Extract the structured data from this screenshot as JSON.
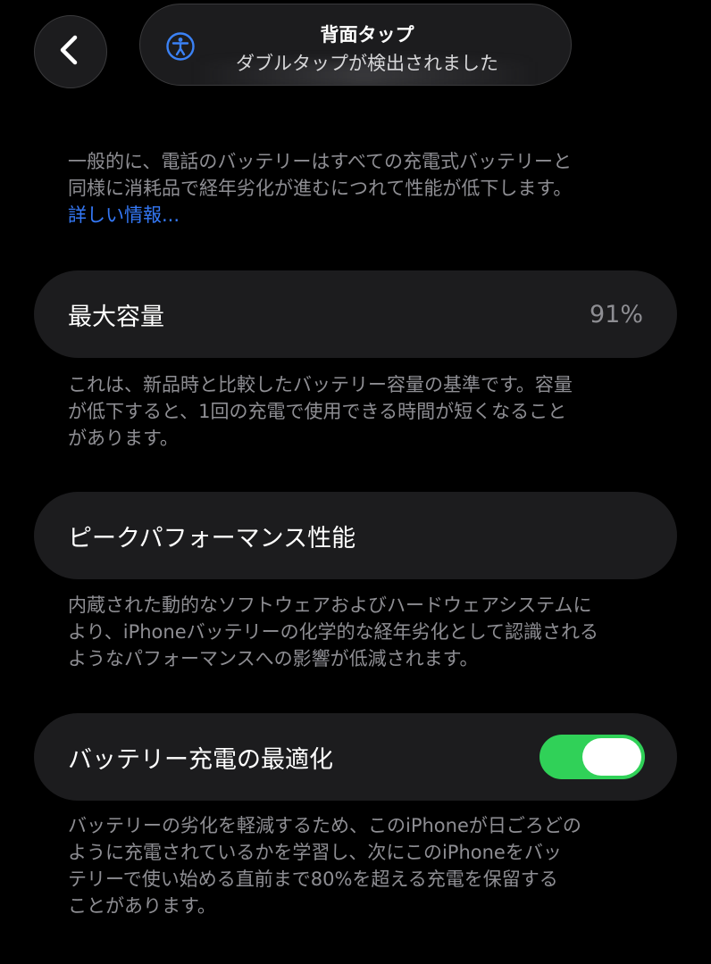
{
  "nav": {
    "back_icon": "chevron-left-icon"
  },
  "banner": {
    "icon": "accessibility-icon",
    "title": "背面タップ",
    "subtitle": "ダブルタップが検出されました"
  },
  "intro": {
    "line1": "一般的に、電話のバッテリーはすべての充電式バッテリーと",
    "line2": "同様に消耗品で経年劣化が進むにつれて性能が低下します。",
    "link": "詳しい情報..."
  },
  "max_capacity": {
    "label": "最大容量",
    "value": "91%",
    "desc_line1": "これは、新品時と比較したバッテリー容量の基準です。容量",
    "desc_line2": "が低下すると、1回の充電で使用できる時間が短くなること",
    "desc_line3": "があります。"
  },
  "peak_performance": {
    "label": "ピークパフォーマンス性能",
    "desc_line1": "内蔵された動的なソフトウェアおよびハードウェアシステムに",
    "desc_line2": "より、iPhoneバッテリーの化学的な経年劣化として認識される",
    "desc_line3": "ようなパフォーマンスへの影響が低減されます。"
  },
  "optimized_charging": {
    "label": "バッテリー充電の最適化",
    "enabled": true,
    "desc_line1": "バッテリーの劣化を軽減するため、このiPhoneが日ごろどの",
    "desc_line2": "ように充電されているかを学習し、次にこのiPhoneをバッ",
    "desc_line3": "テリーで使い始める直前まで80%を超える充電を保留する",
    "desc_line4": "ことがあります。"
  },
  "colors": {
    "background": "#000000",
    "card": "#1c1c1e",
    "secondary_text": "#8e8e93",
    "link": "#3478f6",
    "toggle_on": "#30d158"
  }
}
